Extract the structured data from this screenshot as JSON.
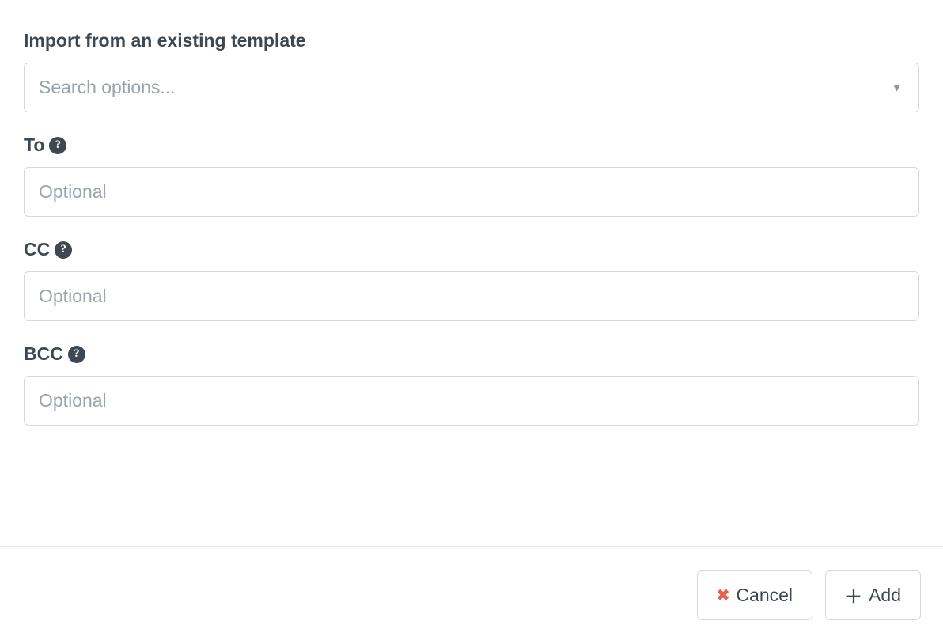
{
  "form": {
    "import": {
      "label": "Import from an existing template",
      "placeholder": "Search options..."
    },
    "to": {
      "label": "To",
      "placeholder": "Optional"
    },
    "cc": {
      "label": "CC",
      "placeholder": "Optional"
    },
    "bcc": {
      "label": "BCC",
      "placeholder": "Optional"
    }
  },
  "footer": {
    "cancel_label": "Cancel",
    "add_label": "Add"
  }
}
